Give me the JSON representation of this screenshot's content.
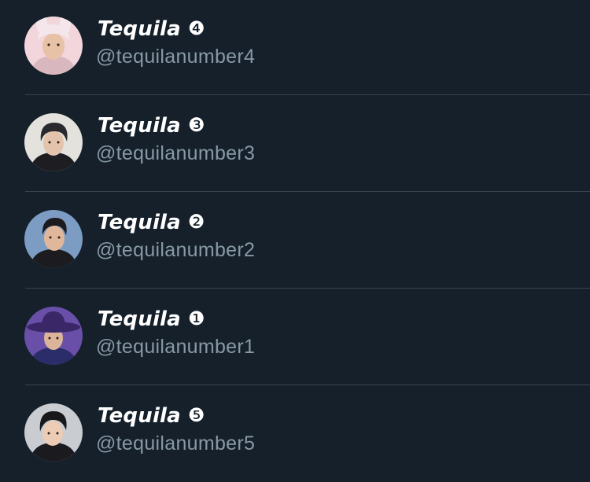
{
  "accounts": [
    {
      "display_name": "Tequila",
      "badge": "❹",
      "handle": "@tequilanumber4",
      "avatar": {
        "icon": "avatar-person-bunny-hat",
        "bg": "#f2d6dc",
        "hair": "#f4e6ea",
        "skin": "#e8c2a6",
        "shirt": "#d9b7bf"
      }
    },
    {
      "display_name": "Tequila",
      "badge": "❸",
      "handle": "@tequilanumber3",
      "avatar": {
        "icon": "avatar-person",
        "bg": "#e4e2dc",
        "hair": "#2a2a2e",
        "skin": "#e4c3ac",
        "shirt": "#1d1d22"
      }
    },
    {
      "display_name": "Tequila",
      "badge": "❷",
      "handle": "@tequilanumber2",
      "avatar": {
        "icon": "avatar-person",
        "bg": "#7d9cc4",
        "hair": "#1c1a1c",
        "skin": "#e0b79a",
        "shirt": "#1b1b20"
      }
    },
    {
      "display_name": "Tequila",
      "badge": "❶",
      "handle": "@tequilanumber1",
      "avatar": {
        "icon": "avatar-person-hat",
        "bg": "#6a4fa8",
        "hair": "#20152e",
        "skin": "#dcb49a",
        "shirt": "#2b2d6b",
        "hat": "#3a2768"
      }
    },
    {
      "display_name": "Tequila",
      "badge": "❺",
      "handle": "@tequilanumber5",
      "avatar": {
        "icon": "avatar-person",
        "bg": "#c9ccd0",
        "hair": "#18181b",
        "skin": "#ecccb4",
        "shirt": "#1a1a1f"
      }
    }
  ]
}
